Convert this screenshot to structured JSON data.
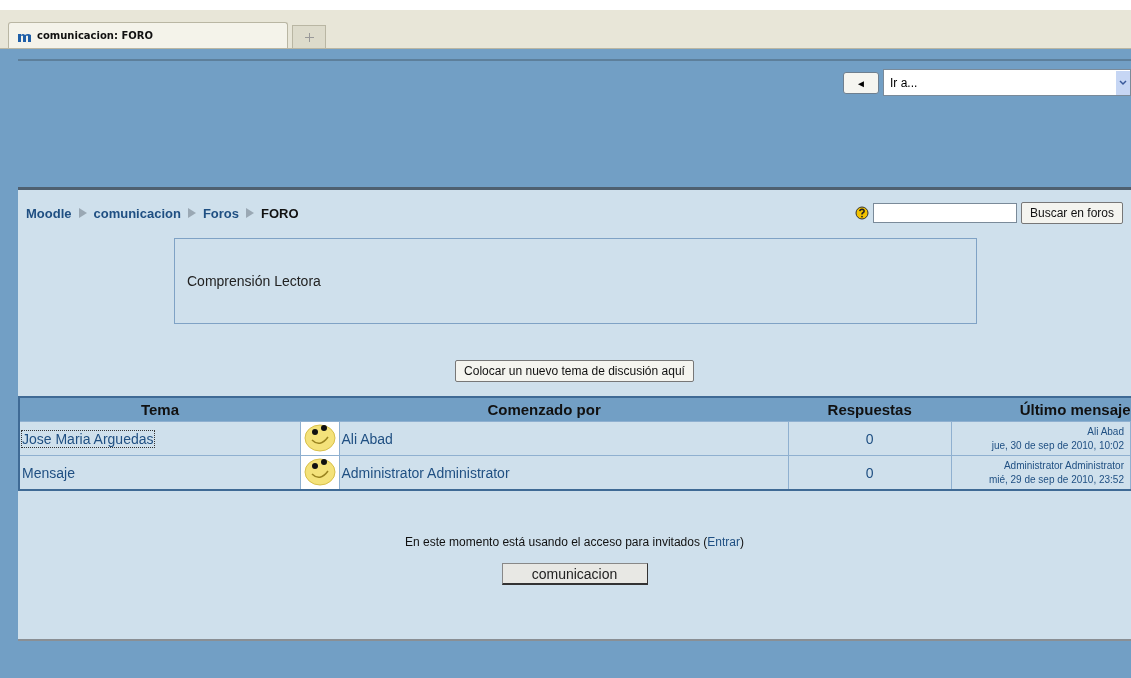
{
  "browser_tabs": [
    {
      "label": "comunicacion: FORO",
      "selected": true
    }
  ],
  "header": {
    "back_button": "◄",
    "jump_menu": {
      "value": "Ir a..."
    }
  },
  "breadcrumb": [
    {
      "label": "Moodle",
      "kind": "link"
    },
    {
      "label": "comunicacion",
      "kind": "link"
    },
    {
      "label": "Foros",
      "kind": "link"
    },
    {
      "label": "FORO",
      "kind": "current"
    }
  ],
  "search": {
    "button": "Buscar en foros"
  },
  "forum_intro": "Comprensión Lectora",
  "new_topic_button": "Colocar un nuevo tema de discusión aquí",
  "table": {
    "columns": [
      "Tema",
      "Comenzado por",
      "Respuestas",
      "Último mensaje"
    ],
    "rows": [
      {
        "topic": "Jose Maria Arguedas",
        "focused": true,
        "author": "Ali Abad",
        "replies": "0",
        "last_author": "Ali Abad",
        "last_date": "jue, 30 de sep de 2010, 10:02"
      },
      {
        "topic": "Mensaje",
        "focused": false,
        "author": "Administrator Administrator",
        "replies": "0",
        "last_author": "Administrator Administrator",
        "last_date": "mié, 29 de sep de 2010, 23:52"
      }
    ]
  },
  "footer": {
    "guest_text": "En este momento está usando el acceso para invitados (",
    "login_link": "Entrar",
    "guest_text_end": ")",
    "course_button": "comunicacion"
  }
}
